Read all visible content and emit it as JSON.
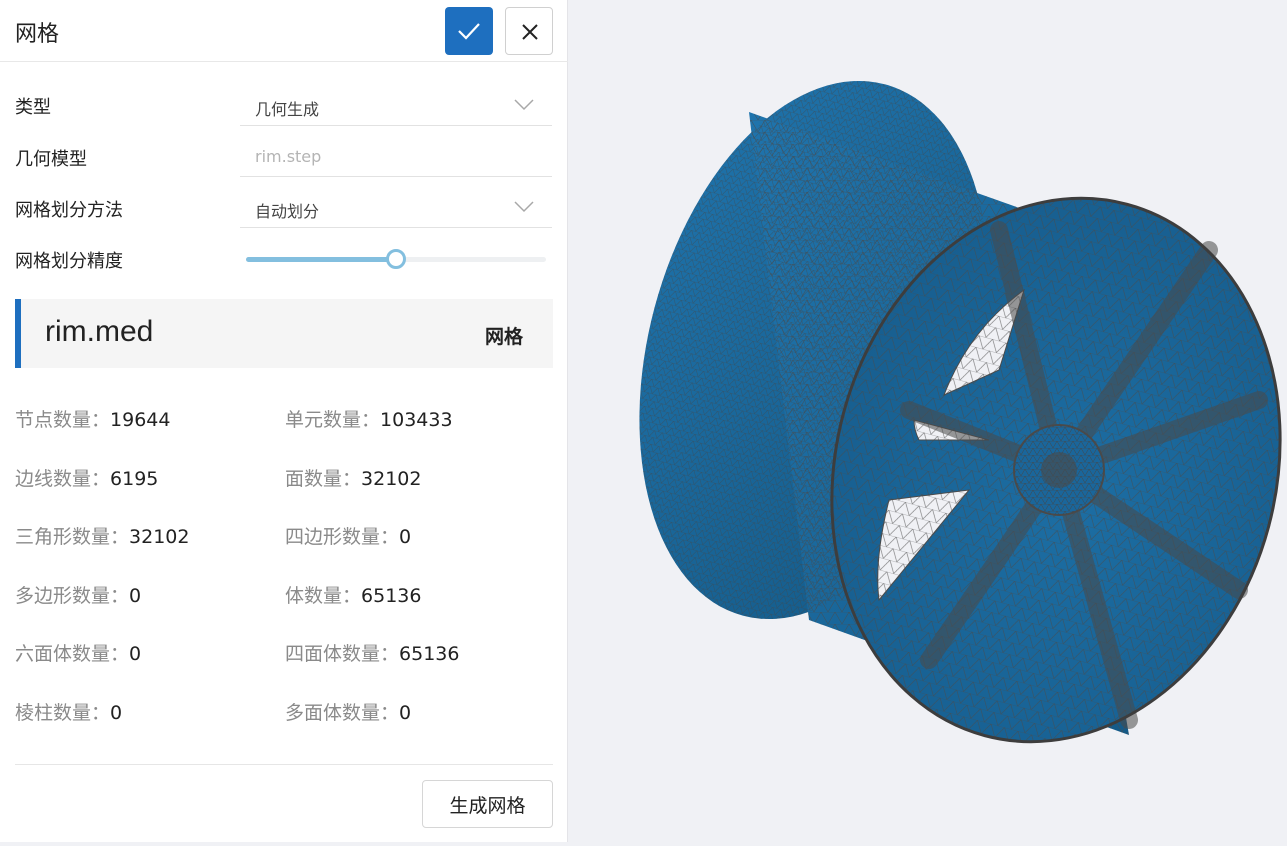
{
  "panel": {
    "title": "网格",
    "confirm_icon": "check-icon",
    "close_icon": "close-icon"
  },
  "form": {
    "type_label": "类型",
    "type_value": "几何生成",
    "geometry_label": "几何模型",
    "geometry_placeholder": "rim.step",
    "method_label": "网格划分方法",
    "method_value": "自动划分",
    "precision_label": "网格划分精度",
    "precision_value": 0.5
  },
  "file": {
    "name": "rim.med",
    "tag": "网格"
  },
  "stats": [
    {
      "label": "节点数量：",
      "value": "19644"
    },
    {
      "label": "单元数量：",
      "value": "103433"
    },
    {
      "label": "边线数量：",
      "value": "6195"
    },
    {
      "label": "面数量：",
      "value": "32102"
    },
    {
      "label": "三角形数量：",
      "value": "32102"
    },
    {
      "label": "四边形数量：",
      "value": "0"
    },
    {
      "label": "多边形数量：",
      "value": "0"
    },
    {
      "label": "体数量：",
      "value": "65136"
    },
    {
      "label": "六面体数量：",
      "value": "0"
    },
    {
      "label": "四面体数量：",
      "value": "65136"
    },
    {
      "label": "棱柱数量：",
      "value": "0"
    },
    {
      "label": "多面体数量：",
      "value": "0"
    }
  ],
  "actions": {
    "generate_label": "生成网格"
  },
  "colors": {
    "accent": "#1e6fbf",
    "slider": "#83bfdf",
    "mesh_fill": "#1c6ea4",
    "mesh_line": "#4a4a4a"
  }
}
